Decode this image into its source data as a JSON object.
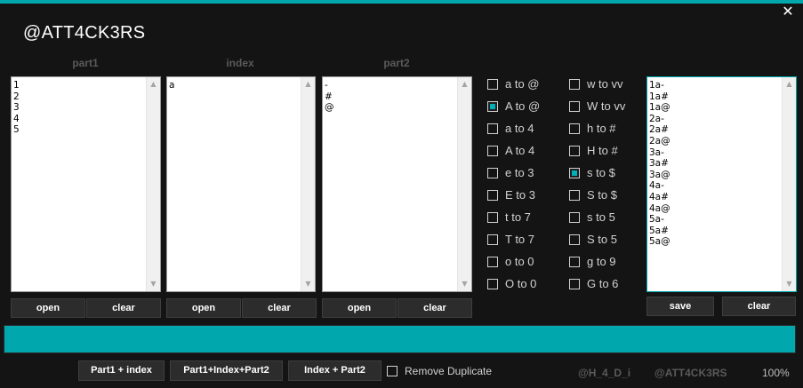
{
  "window": {
    "title": "@ATT4CK3RS",
    "close_glyph": "✕"
  },
  "columns": {
    "part1": {
      "header": "part1",
      "items": [
        "1",
        "2",
        "3",
        "4",
        "5"
      ],
      "open_label": "open",
      "clear_label": "clear"
    },
    "index": {
      "header": "index",
      "items": [
        "a"
      ],
      "open_label": "open",
      "clear_label": "clear"
    },
    "part2": {
      "header": "part2",
      "items": [
        "-",
        "#",
        "@"
      ],
      "open_label": "open",
      "clear_label": "clear"
    }
  },
  "substitutions": {
    "left": [
      {
        "label": "a to @",
        "checked": false
      },
      {
        "label": "A to @",
        "checked": true
      },
      {
        "label": "a to 4",
        "checked": false
      },
      {
        "label": "A to 4",
        "checked": false
      },
      {
        "label": "e to 3",
        "checked": false
      },
      {
        "label": "E to 3",
        "checked": false
      },
      {
        "label": "t to 7",
        "checked": false
      },
      {
        "label": "T to 7",
        "checked": false
      },
      {
        "label": "o to 0",
        "checked": false
      },
      {
        "label": "O to 0",
        "checked": false
      }
    ],
    "right": [
      {
        "label": "w to vv",
        "checked": false
      },
      {
        "label": "W to vv",
        "checked": false
      },
      {
        "label": "h to #",
        "checked": false
      },
      {
        "label": "H to #",
        "checked": false
      },
      {
        "label": "s to $",
        "checked": true
      },
      {
        "label": "S to $",
        "checked": false
      },
      {
        "label": "s to 5",
        "checked": false
      },
      {
        "label": "S to 5",
        "checked": false
      },
      {
        "label": "g to 9",
        "checked": false
      },
      {
        "label": "G to 6",
        "checked": false
      }
    ]
  },
  "output": {
    "items": [
      "1a-",
      "1a#",
      "1a@",
      "2a-",
      "2a#",
      "2a@",
      "3a-",
      "3a#",
      "3a@",
      "4a-",
      "4a#",
      "4a@",
      "5a-",
      "5a#",
      "5a@"
    ],
    "save_label": "save",
    "clear_label": "clear"
  },
  "progress": {
    "value": 1.0,
    "color": "#00a7ad"
  },
  "actions": {
    "part1_index": "Part1 + index",
    "part1_index_part2": "Part1+Index+Part2",
    "index_part2": "Index + Part2",
    "remove_duplicate": {
      "label": "Remove Duplicate",
      "checked": false
    }
  },
  "footer": {
    "credit1": "@H_4_D_i",
    "credit2": "@ATT4CK3RS",
    "percent": "100%"
  },
  "colors": {
    "accent": "#00a7ad",
    "background": "#141414"
  }
}
